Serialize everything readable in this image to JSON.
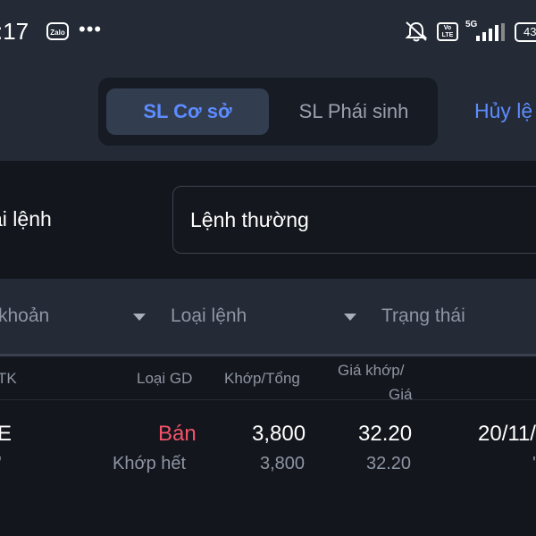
{
  "status_bar": {
    "time": ":17",
    "zalo_label": "Zalo",
    "more": "•••",
    "volte_label": "Vo LTE",
    "network": "5G",
    "battery": "43"
  },
  "tabs": {
    "items": [
      {
        "label": "SL Cơ sở",
        "active": true
      },
      {
        "label": "SL Phái sinh",
        "active": false
      }
    ],
    "cancel_label": "Hủy lệ"
  },
  "order_type": {
    "label": "ại lệnh",
    "value": "Lệnh thường"
  },
  "filters": {
    "account": "khoản",
    "order_kind": "Loại lệnh",
    "status": "Trạng thái"
  },
  "table": {
    "headers": {
      "account": "TK",
      "side": "Loại GD",
      "matched_total": "Khớp/Tổng",
      "price_line1": "Giá khớp/",
      "price_line2": "Giá"
    },
    "rows": [
      {
        "symbol": "E",
        "symbol_sub": "'",
        "side": "Bán",
        "status": "Khớp hết",
        "matched": "3,800",
        "total": "3,800",
        "match_price": "32.20",
        "order_price": "32.20",
        "date": "20/11/",
        "date_sub": "'"
      }
    ]
  },
  "colors": {
    "accent": "#5c8cff",
    "sell": "#f2536b",
    "background": "#13161c",
    "panel": "#242a36"
  }
}
